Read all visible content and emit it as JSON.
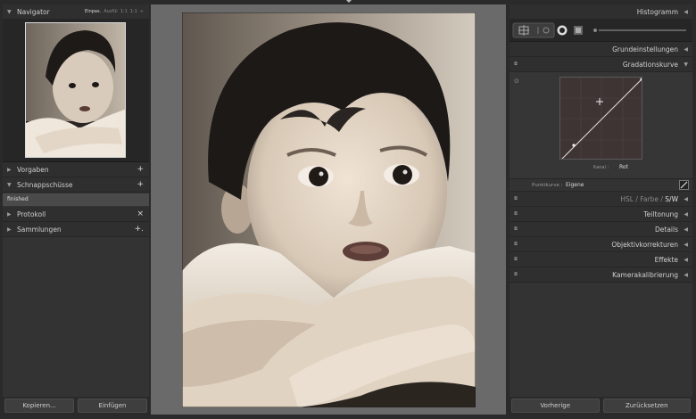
{
  "left": {
    "navigator": {
      "title": "Navigator",
      "zoom_fit": "Einpas.",
      "zoom_fill": "Ausfül",
      "zoom_1_1": "1:1",
      "zoom_custom": "1:1"
    },
    "panels": [
      {
        "title": "Vorgaben",
        "action": "+"
      },
      {
        "title": "Schnappschüsse",
        "action": "+"
      },
      {
        "title": "Protokoll",
        "action": "×"
      },
      {
        "title": "Sammlungen",
        "action": "+."
      }
    ],
    "snapshot_item": "finished",
    "buttons": {
      "copy": "Kopieren...",
      "paste": "Einfügen"
    }
  },
  "right": {
    "histogram": "Histogramm",
    "grund": "Grundeinstellungen",
    "gradation": "Gradationskurve",
    "kanal_label": "Kanal :",
    "kanal_value": "Rot",
    "punktkurve_label": "Punktkurve :",
    "punktkurve_value": "Eigene",
    "hsl": {
      "hsl": "HSL",
      "farbe": "Farbe",
      "sw": "S/W",
      "sep1": "/",
      "sep2": "/"
    },
    "sections": [
      "Teiltonung",
      "Details",
      "Objektivkorrekturen",
      "Effekte",
      "Kamerakalibrierung"
    ],
    "buttons": {
      "prev": "Vorherige",
      "reset": "Zurücksetzen"
    }
  },
  "icons": {
    "collapse": "triangle-right-icon",
    "expand": "triangle-down-icon",
    "panel_switch": "toggle-switch-icon"
  }
}
